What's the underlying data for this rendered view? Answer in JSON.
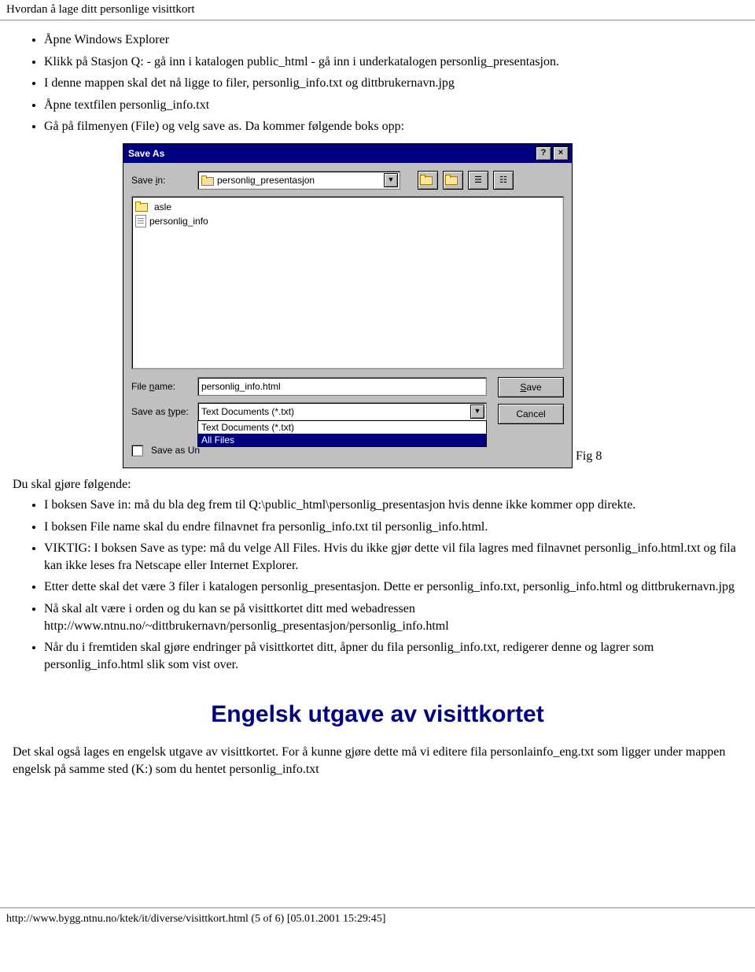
{
  "header_title": "Hvordan å lage ditt personlige visittkort",
  "list1": {
    "i0": "Åpne Windows Explorer",
    "i1": "Klikk på Stasjon Q: - gå inn i katalogen public_html - gå inn i underkatalogen personlig_presentasjon.",
    "i2": "I denne mappen skal det nå ligge to filer, personlig_info.txt og dittbrukernavn.jpg",
    "i3": "Åpne textfilen personlig_info.txt",
    "i4": "Gå på filmenyen (File) og velg save as. Da kommer følgende boks opp:"
  },
  "dialog": {
    "title": "Save As",
    "help": "?",
    "close": "×",
    "save_in_label_pre": "Save ",
    "save_in_label_u": "i",
    "save_in_label_post": "n:",
    "save_in_value": "personlig_presentasjon",
    "list": {
      "i0": "asle",
      "i1": "personlig_info"
    },
    "file_name_label_pre": "File ",
    "file_name_label_u": "n",
    "file_name_label_post": "ame:",
    "file_name_value": "personlig_info.html",
    "save_as_type_label_pre": "Save as ",
    "save_as_type_label_u": "t",
    "save_as_type_label_post": "ype:",
    "save_as_type_value": "Text Documents (*.txt)",
    "dd_opt0": "Text Documents (*.txt)",
    "dd_opt1": "All Files",
    "save_as_unicode_pre": "Save as Un",
    "save_btn_u": "S",
    "save_btn_rest": "ave",
    "cancel_btn": "Cancel"
  },
  "fig_caption": "Fig 8",
  "subhead": "Du skal gjøre følgende:",
  "list2": {
    "i0": "I boksen Save in: må du bla deg frem til Q:\\public_html\\personlig_presentasjon hvis denne ikke kommer opp direkte.",
    "i1": "I boksen File name skal du endre filnavnet fra personlig_info.txt til personlig_info.html.",
    "i2": "VIKTIG: I boksen Save as type: må du velge All Files. Hvis du ikke gjør dette vil fila lagres med filnavnet personlig_info.html.txt og fila kan ikke leses fra Netscape eller Internet Explorer.",
    "i3": "Etter dette skal det være 3 filer i katalogen personlig_presentasjon. Dette er personlig_info.txt, personlig_info.html og dittbrukernavn.jpg",
    "i4": "Nå skal alt være i orden og du kan se på visittkortet ditt med webadressen http://www.ntnu.no/~dittbrukernavn/personlig_presentasjon/personlig_info.html",
    "i5": "Når du i fremtiden skal gjøre endringer på visittkortet ditt, åpner du fila personlig_info.txt, redigerer denne og lagrer som personlig_info.html slik som vist over."
  },
  "section_heading": "Engelsk utgave av visittkortet",
  "para_eng": "Det skal også lages en engelsk utgave av visittkortet. For å kunne gjøre dette må vi editere fila personlainfo_eng.txt som ligger under mappen engelsk på samme sted (K:) som du hentet personlig_info.txt",
  "footer": "http://www.bygg.ntnu.no/ktek/it/diverse/visittkort.html (5 of 6) [05.01.2001 15:29:45]"
}
